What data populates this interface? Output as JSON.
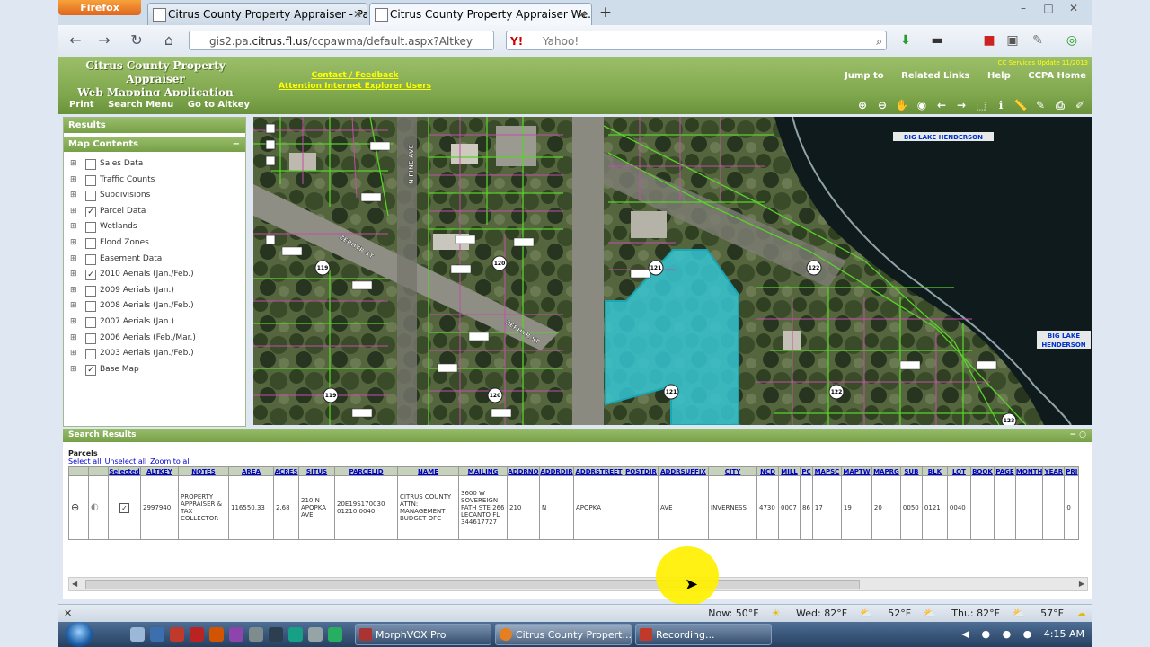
{
  "browser": {
    "menu_button": "Firefox",
    "tabs": [
      {
        "title": "Citrus County Property Appraiser - Pa..."
      },
      {
        "title": "Citrus County Property Appraiser We..."
      }
    ],
    "new_tab": "+",
    "url_prefix": "gis2.pa.",
    "url_domain": "citrus.fl.us",
    "url_path": "/ccpawma/default.aspx?Altkey",
    "search_engine": "Y!",
    "search_placeholder": "Yahoo!",
    "window_controls": [
      "–",
      "□",
      "✕"
    ]
  },
  "app": {
    "title_line1": "Citrus County Property Appraiser",
    "title_line2": "Web Mapping Application",
    "link_contact": "Contact / Feedback",
    "link_ie_notice": "Attention Internet Explorer Users",
    "header_note": "CC Services Update 11/2013",
    "nav_links": [
      "Jump to",
      "Related Links",
      "Help",
      "CCPA Home"
    ],
    "menu_items": [
      "Print",
      "Search Menu",
      "Go to Altkey"
    ]
  },
  "left_panel": {
    "results_header": "Results",
    "contents_header": "Map Contents",
    "layers": [
      {
        "label": "Sales Data",
        "checked": false
      },
      {
        "label": "Traffic Counts",
        "checked": false
      },
      {
        "label": "Subdivisions",
        "checked": false
      },
      {
        "label": "Parcel Data",
        "checked": true
      },
      {
        "label": "Wetlands",
        "checked": false
      },
      {
        "label": "Flood Zones",
        "checked": false
      },
      {
        "label": "Easement Data",
        "checked": false
      },
      {
        "label": "2010 Aerials (Jan./Feb.)",
        "checked": true
      },
      {
        "label": "2009 Aerials (Jan.)",
        "checked": false
      },
      {
        "label": "2008 Aerials (Jan./Feb.)",
        "checked": false
      },
      {
        "label": "2007 Aerials (Jan.)",
        "checked": false
      },
      {
        "label": "2006 Aerials (Feb./Mar.)",
        "checked": false
      },
      {
        "label": "2003 Aerials (Jan./Feb.)",
        "checked": false
      },
      {
        "label": "Base Map",
        "checked": true
      }
    ]
  },
  "map": {
    "labels": {
      "lake1": "BIG LAKE HENDERSON",
      "lake2_line1": "BIG LAKE",
      "lake2_line2": "HENDERSON",
      "street_pine": "N PINE AVE",
      "street_1": "ZEPHYR ST",
      "street_2": "ZEPHYR ST",
      "route": [
        "121",
        "121",
        "121",
        "120",
        "120",
        "122",
        "122",
        "119",
        "119",
        "123"
      ]
    }
  },
  "search_results": {
    "header": "Search Results",
    "parcels_label": "Parcels",
    "select_all": "Select all",
    "unselect_all": "Unselect all",
    "zoom_to_all": "Zoom to all",
    "columns": [
      "",
      "",
      "Selected",
      "ALTKEY",
      "NOTES",
      "AREA",
      "ACRES",
      "SITUS",
      "PARCELID",
      "NAME",
      "MAILING",
      "ADDRNO",
      "ADDRDIR",
      "ADDRSTREET",
      "POSTDIR",
      "ADDRSUFFIX",
      "CITY",
      "NCD",
      "MILL",
      "PC",
      "MAPSC",
      "MAPTW",
      "MAPRG",
      "SUB",
      "BLK",
      "LOT",
      "BOOK",
      "PAGE",
      "MONTH",
      "YEAR",
      "PRI"
    ],
    "row": [
      "",
      "",
      "✓",
      "2997940",
      "PROPERTY APPRAISER & TAX COLLECTOR",
      "116550.33",
      "2.68",
      "210 N APOPKA AVE",
      "20E19S170030 01210 0040",
      "CITRUS COUNTY ATTN: MANAGEMENT BUDGET OFC",
      "3600 W SOVEREIGN PATH STE 266 LECANTO FL 344617727",
      "210",
      "N",
      "APOPKA",
      "",
      "AVE",
      "INVERNESS",
      "4730",
      "0007",
      "86",
      "17",
      "19",
      "20",
      "0050",
      "0121",
      "0040",
      "",
      "",
      "",
      "",
      "0"
    ]
  },
  "statusbar": {
    "close": "✕",
    "weather": [
      {
        "label": "Now: 50°F"
      },
      {
        "label": "Wed: 82°F"
      },
      {
        "label": "52°F"
      },
      {
        "label": "Thu: 82°F"
      },
      {
        "label": "57°F"
      }
    ]
  },
  "taskbar": {
    "items": [
      {
        "label": "MorphVOX Pro"
      },
      {
        "label": "Citrus County Propert..."
      },
      {
        "label": "Recording..."
      }
    ],
    "clock": "4:15 AM"
  },
  "colors": {
    "header_green": "#7ea64b",
    "selection_cyan": "#36c6d2",
    "parcel_line": "#59d22a",
    "lot_line": "#c24fa6",
    "link_blue": "#0000cc"
  }
}
